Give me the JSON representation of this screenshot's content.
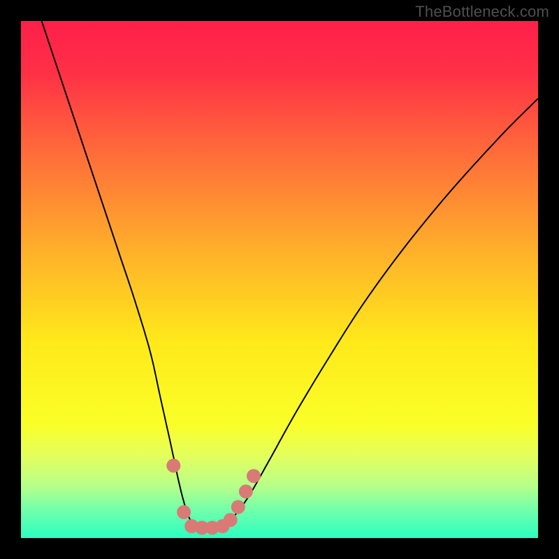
{
  "watermark": {
    "text": "TheBottleneck.com"
  },
  "chart_data": {
    "type": "line",
    "title": "",
    "xlabel": "",
    "ylabel": "",
    "xlim": [
      0,
      100
    ],
    "ylim": [
      0,
      100
    ],
    "grid": false,
    "legend": false,
    "background_gradient_stops": [
      {
        "offset": 0.0,
        "color": "#ff1f4a"
      },
      {
        "offset": 0.1,
        "color": "#ff3046"
      },
      {
        "offset": 0.25,
        "color": "#ff6a3a"
      },
      {
        "offset": 0.45,
        "color": "#ffb22a"
      },
      {
        "offset": 0.62,
        "color": "#ffe91a"
      },
      {
        "offset": 0.78,
        "color": "#faff28"
      },
      {
        "offset": 0.84,
        "color": "#e4ff5c"
      },
      {
        "offset": 0.9,
        "color": "#b6ff8a"
      },
      {
        "offset": 0.95,
        "color": "#6cffad"
      },
      {
        "offset": 1.0,
        "color": "#2bffc0"
      }
    ],
    "series": [
      {
        "name": "bottleneck-curve",
        "stroke": "#000000",
        "stroke_width": 2,
        "x": [
          4,
          7,
          10,
          13,
          16,
          19,
          22,
          25,
          27,
          29,
          30.5,
          31.5,
          32.5,
          33.5,
          35,
          37,
          39,
          41,
          44,
          48,
          53,
          59,
          66,
          74,
          83,
          93,
          100
        ],
        "y": [
          100,
          91,
          82,
          73,
          64,
          55,
          46,
          36,
          27,
          18,
          11,
          7,
          4,
          2.5,
          2,
          2,
          2.5,
          4,
          8,
          15,
          24,
          34,
          45,
          56,
          67,
          78,
          85
        ]
      }
    ],
    "markers": {
      "name": "highlight-dots",
      "color": "#d97a77",
      "radius": 10,
      "points": [
        {
          "x": 29.5,
          "y": 14
        },
        {
          "x": 31.5,
          "y": 5
        },
        {
          "x": 33.0,
          "y": 2.3
        },
        {
          "x": 35.0,
          "y": 2.0
        },
        {
          "x": 37.0,
          "y": 2.0
        },
        {
          "x": 39.0,
          "y": 2.3
        },
        {
          "x": 40.5,
          "y": 3.5
        },
        {
          "x": 42.0,
          "y": 6
        },
        {
          "x": 43.5,
          "y": 9
        },
        {
          "x": 45.0,
          "y": 12
        }
      ]
    }
  }
}
